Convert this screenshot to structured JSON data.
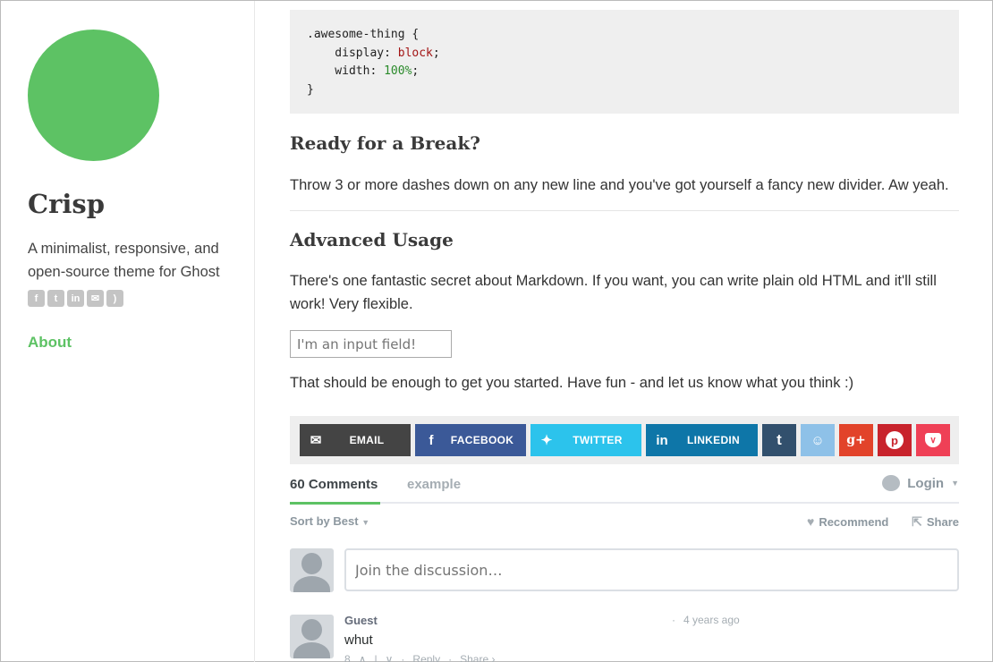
{
  "sidebar": {
    "title": "Crisp",
    "description": "A minimalist, responsive, and open-source theme for Ghost",
    "social_icons": [
      "facebook-icon",
      "twitter-icon",
      "linkedin-icon",
      "email-icon",
      "rss-icon"
    ],
    "nav_about": "About"
  },
  "code": {
    "line1": ".awesome-thing {",
    "prop1": "    display: ",
    "val1": "block",
    "prop2": "    width: ",
    "val2": "100%",
    "close": "}"
  },
  "sections": {
    "break_heading": "Ready for a Break?",
    "break_text": "Throw 3 or more dashes down on any new line and you've got yourself a fancy new divider. Aw yeah.",
    "advanced_heading": "Advanced Usage",
    "advanced_text": "There's one fantastic secret about Markdown. If you want, you can write plain old HTML and it'll still work! Very flexible.",
    "input_placeholder": "I'm an input field!",
    "closing_text": "That should be enough to get you started. Have fun - and let us know what you think :)"
  },
  "share": {
    "email": "EMAIL",
    "facebook": "FACEBOOK",
    "twitter": "TWITTER",
    "linkedin": "LINKEDIN",
    "colors": {
      "email": "#444444",
      "facebook": "#3b5998",
      "twitter": "#2cc3ec",
      "linkedin": "#0e76a8",
      "tumblr": "#32506d",
      "reddit": "#8ec1e8",
      "google": "#e2432a",
      "pinterest": "#c8232c",
      "pocket": "#ef4056"
    }
  },
  "comments": {
    "count_tab": "60 Comments",
    "community_tab": "example",
    "login": "Login",
    "sort": "Sort by Best",
    "recommend": "Recommend",
    "share": "Share",
    "compose_placeholder": "Join the discussion…",
    "items": [
      {
        "author": "Guest",
        "time": "4 years ago",
        "text": "whut",
        "votes": "8",
        "reply": "Reply",
        "share": "Share ›"
      }
    ]
  },
  "accent_color": "#5dc264"
}
